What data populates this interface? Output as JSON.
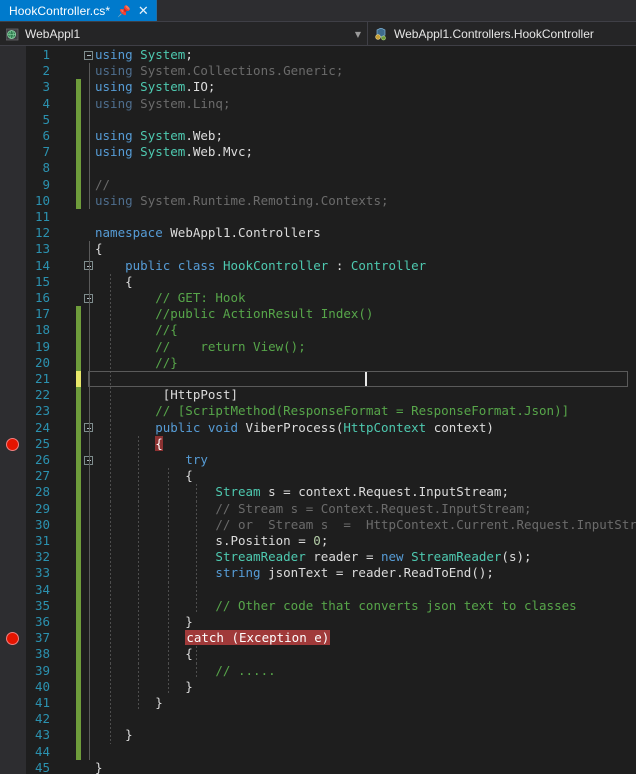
{
  "window": {
    "app": "Visual Studio",
    "theme_background": "#1E1E1E",
    "accent": "#007ACC"
  },
  "tab_strip": {
    "tabs": [
      {
        "title": "HookController.cs*",
        "pin_icon": "pin-icon",
        "close_icon": "close-icon",
        "active": true
      }
    ]
  },
  "nav_bar": {
    "project": {
      "icon": "project-globe-icon",
      "label": "WebAppl1",
      "dropdown_icon": "chevron-down-icon"
    },
    "member": {
      "icon": "class-member-icon",
      "label": "WebAppl1.Controllers.HookController"
    }
  },
  "editor": {
    "language": "csharp",
    "first_line": 1,
    "last_line": 45,
    "current_line": 21,
    "breakpoint_lines": [
      25,
      37
    ],
    "breakpoint_icon": "breakpoint-circle-icon",
    "lines": [
      {
        "n": 1,
        "text": "using System;"
      },
      {
        "n": 2,
        "text": "using System.Collections.Generic;"
      },
      {
        "n": 3,
        "text": "using System.IO;"
      },
      {
        "n": 4,
        "text": "using System.Linq;"
      },
      {
        "n": 5,
        "text": ""
      },
      {
        "n": 6,
        "text": "using System.Web;"
      },
      {
        "n": 7,
        "text": "using System.Web.Mvc;"
      },
      {
        "n": 8,
        "text": ""
      },
      {
        "n": 9,
        "text": "//"
      },
      {
        "n": 10,
        "text": "using System.Runtime.Remoting.Contexts;"
      },
      {
        "n": 11,
        "text": ""
      },
      {
        "n": 12,
        "text": "namespace WebAppl1.Controllers"
      },
      {
        "n": 13,
        "text": "{"
      },
      {
        "n": 14,
        "text": "    public class HookController : Controller"
      },
      {
        "n": 15,
        "text": "    {"
      },
      {
        "n": 16,
        "text": "        // GET: Hook"
      },
      {
        "n": 17,
        "text": "        //public ActionResult Index()"
      },
      {
        "n": 18,
        "text": "        //{"
      },
      {
        "n": 19,
        "text": "        //    return View();"
      },
      {
        "n": 20,
        "text": "        //}"
      },
      {
        "n": 21,
        "text": ""
      },
      {
        "n": 22,
        "text": "         [HttpPost]"
      },
      {
        "n": 23,
        "text": "        // [ScriptMethod(ResponseFormat = ResponseFormat.Json)]"
      },
      {
        "n": 24,
        "text": "        public void ViberProcess(HttpContext context)"
      },
      {
        "n": 25,
        "text": "        {"
      },
      {
        "n": 26,
        "text": "            try"
      },
      {
        "n": 27,
        "text": "            {"
      },
      {
        "n": 28,
        "text": "                Stream s = context.Request.InputStream;"
      },
      {
        "n": 29,
        "text": "                // Stream s = Context.Request.InputStream;"
      },
      {
        "n": 30,
        "text": "                // or  Stream s  =  HttpContext.Current.Request.InputStream;"
      },
      {
        "n": 31,
        "text": "                s.Position = 0;"
      },
      {
        "n": 32,
        "text": "                StreamReader reader = new StreamReader(s);"
      },
      {
        "n": 33,
        "text": "                string jsonText = reader.ReadToEnd();"
      },
      {
        "n": 34,
        "text": ""
      },
      {
        "n": 35,
        "text": "                // Other code that converts json text to classes"
      },
      {
        "n": 36,
        "text": "            }"
      },
      {
        "n": 37,
        "text": "            catch (Exception e)"
      },
      {
        "n": 38,
        "text": "            {"
      },
      {
        "n": 39,
        "text": "                // ....."
      },
      {
        "n": 40,
        "text": "            }"
      },
      {
        "n": 41,
        "text": "        }"
      },
      {
        "n": 42,
        "text": ""
      },
      {
        "n": 43,
        "text": "    }"
      },
      {
        "n": 44,
        "text": ""
      },
      {
        "n": 45,
        "text": "}"
      }
    ],
    "colors": {
      "keyword": "#569CD6",
      "type": "#4EC9B0",
      "comment": "#57A64A",
      "disabled_code": "#6B6B6B",
      "number": "#B5CEA8",
      "plain": "#DCDCDC",
      "line_number": "#2B91AF",
      "change_bar_saved": "#6E9C3B",
      "change_bar_unsaved": "#E8E86A",
      "breakpoint_highlight": "#A03A3A"
    }
  }
}
